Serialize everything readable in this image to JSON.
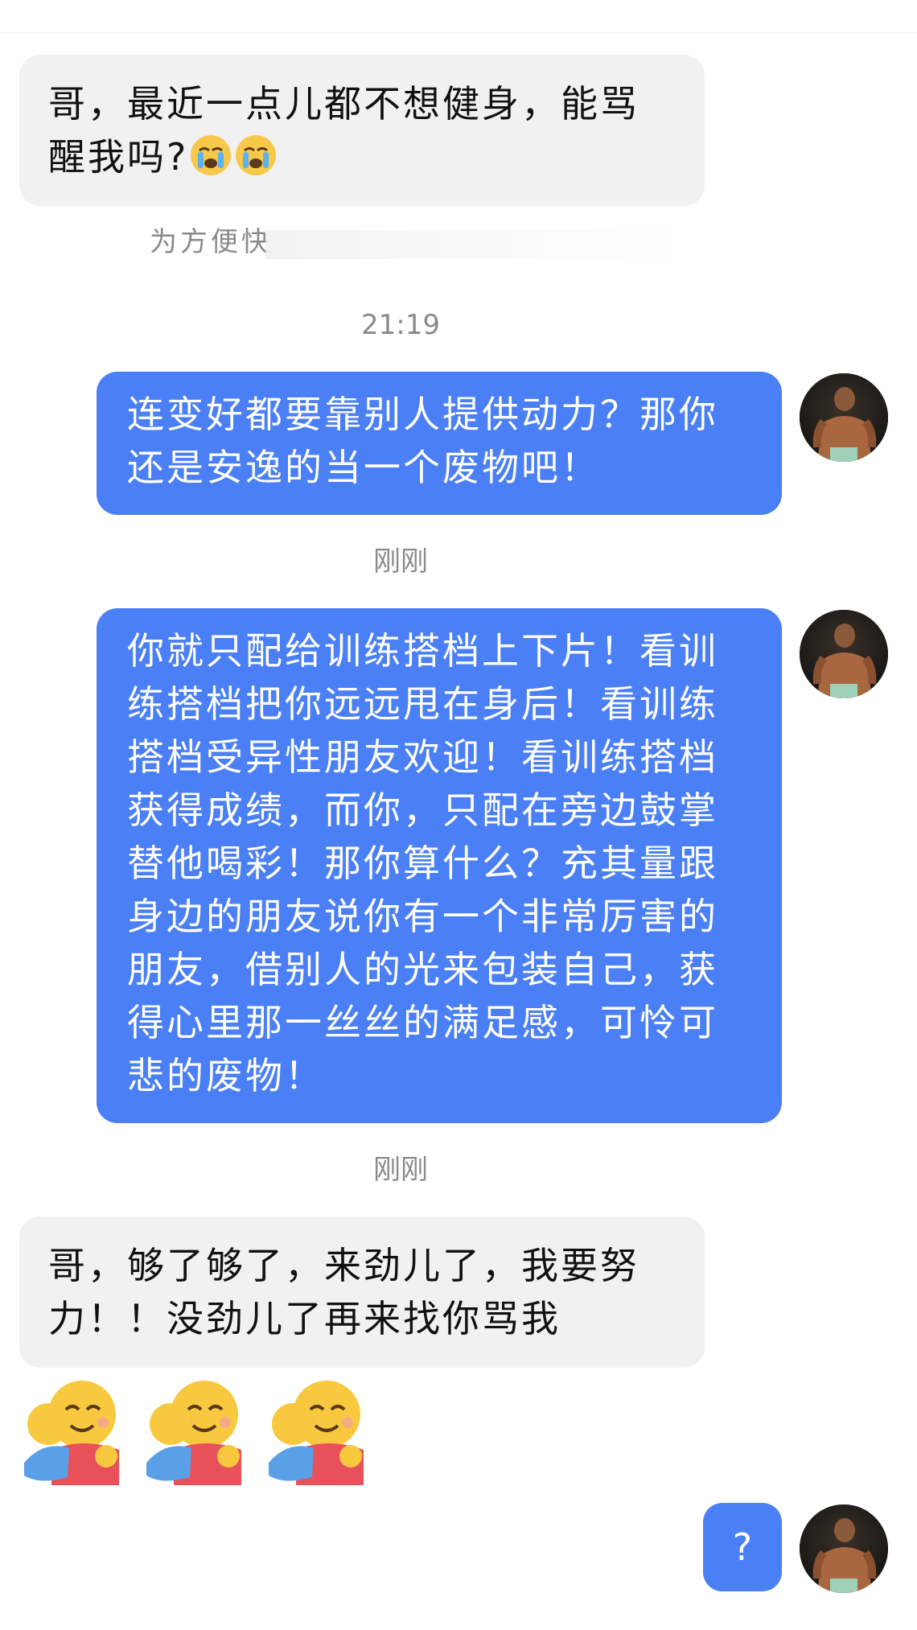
{
  "messages": [
    {
      "side": "left",
      "text": "哥，最近一点儿都不想健身，能骂醒我吗?"
    },
    {
      "side": "right",
      "text": "连变好都要靠别人提供动力？那你还是安逸的当一个废物吧！"
    },
    {
      "side": "right",
      "text": "你就只配给训练搭档上下片！看训练搭档把你远远甩在身后！看训练搭档受异性朋友欢迎！看训练搭档获得成绩，而你，只配在旁边鼓掌替他喝彩！那你算什么？充其量跟身边的朋友说你有一个非常厉害的朋友，借别人的光来包装自己，获得心里那一丝丝的满足感，可怜可悲的废物！"
    },
    {
      "side": "left",
      "text": "哥，够了够了，来劲儿了，我要努力！！没劲儿了再来找你骂我"
    },
    {
      "side": "right",
      "text": "?"
    }
  ],
  "hint_text": "为方便快",
  "timestamps": [
    "21:19",
    "刚刚",
    "刚刚"
  ],
  "emojis": [
    "crying-face",
    "crying-face",
    "hugging-face",
    "hugging-face",
    "hugging-face"
  ],
  "colors": {
    "sent_bubble": "#4a7ff5",
    "received_bubble": "#f1f1f1",
    "timestamp_text": "#8a8a8a"
  }
}
